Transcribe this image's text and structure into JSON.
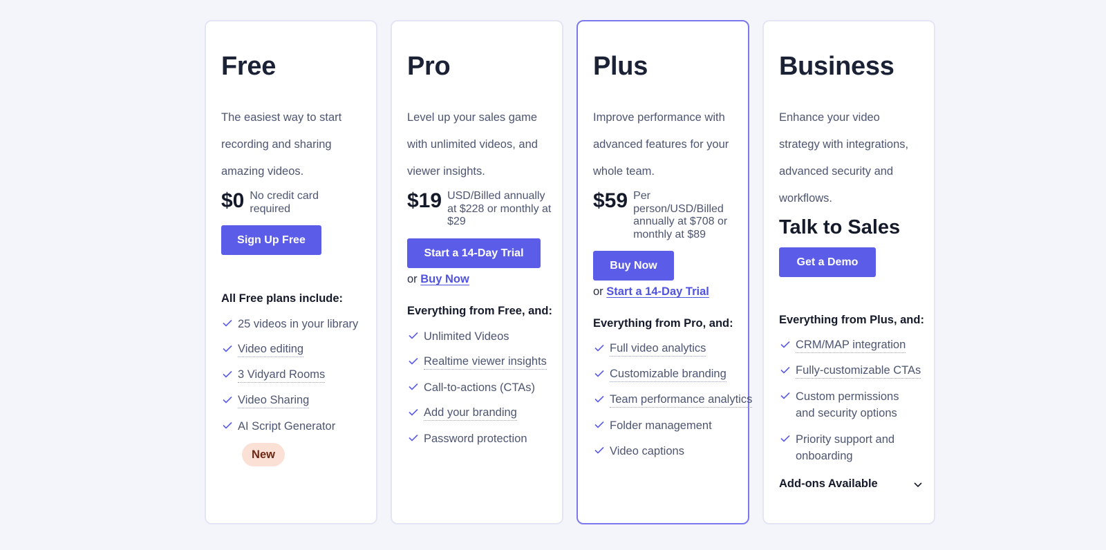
{
  "colors": {
    "accent": "#5b5ce8",
    "featured_border": "#7b78ee",
    "badge_bg": "#fbe0d6",
    "badge_text": "#6b2814",
    "background": "#f4f5fa"
  },
  "plans": [
    {
      "name": "Free",
      "description": "The easiest way to start recording and sharing amazing videos.",
      "price": "$0",
      "price_note": "No credit card required",
      "primary_button": "Sign Up Free",
      "features_heading": "All Free plans include:",
      "features": [
        {
          "label": "25 videos in your library",
          "icon": "check-icon"
        },
        {
          "label": "Video editing",
          "icon": "check-icon"
        },
        {
          "label": "3 Vidyard Rooms",
          "icon": "check-icon"
        },
        {
          "label": "Video Sharing",
          "icon": "check-icon"
        },
        {
          "label": "AI Script Generator",
          "icon": "check-icon",
          "badge": "New"
        }
      ]
    },
    {
      "name": "Pro",
      "description": "Level up your sales game with unlimited videos, and viewer insights.",
      "price": "$19",
      "price_note": "USD/Billed annually at $228 or monthly at $29",
      "primary_button": "Start a 14-Day Trial",
      "alt_prefix": "or",
      "alt_link": "Buy Now",
      "features_heading": "Everything from Free, and:",
      "features": [
        {
          "label": "Unlimited Videos",
          "icon": "check-icon"
        },
        {
          "label": "Realtime viewer insights",
          "icon": "check-icon"
        },
        {
          "label": "Call-to-actions (CTAs)",
          "icon": "check-icon"
        },
        {
          "label": "Add your branding",
          "icon": "check-icon"
        },
        {
          "label": "Password protection",
          "icon": "check-icon"
        }
      ]
    },
    {
      "name": "Plus",
      "description": "Improve performance with advanced features for your whole team.",
      "price": "$59",
      "price_note": "Per person/USD/Billed annually at $708 or monthly at $89",
      "primary_button": "Buy Now",
      "alt_prefix": "or",
      "alt_link": "Start a 14-Day Trial",
      "features_heading": "Everything from Pro, and:",
      "features": [
        {
          "label": "Full video analytics",
          "icon": "check-icon"
        },
        {
          "label": "Customizable branding",
          "icon": "check-icon"
        },
        {
          "label": "Team performance analytics",
          "icon": "check-icon"
        },
        {
          "label": "Folder management",
          "icon": "check-icon"
        },
        {
          "label": "Video captions",
          "icon": "check-icon"
        }
      ]
    },
    {
      "name": "Business",
      "description": "Enhance your video strategy with integrations, advanced security and workflows.",
      "price_headline": "Talk to Sales",
      "primary_button": "Get a Demo",
      "features_heading": "Everything from Plus, and:",
      "features": [
        {
          "label": "CRM/MAP integration",
          "icon": "check-icon"
        },
        {
          "label": "Fully-customizable CTAs",
          "icon": "check-icon"
        },
        {
          "label": "Custom permissions and security options",
          "icon": "check-icon"
        },
        {
          "label": "Priority support and onboarding",
          "icon": "check-icon"
        }
      ],
      "addons_label": "Add-ons Available",
      "addons_icon": "chevron-down-icon"
    }
  ]
}
